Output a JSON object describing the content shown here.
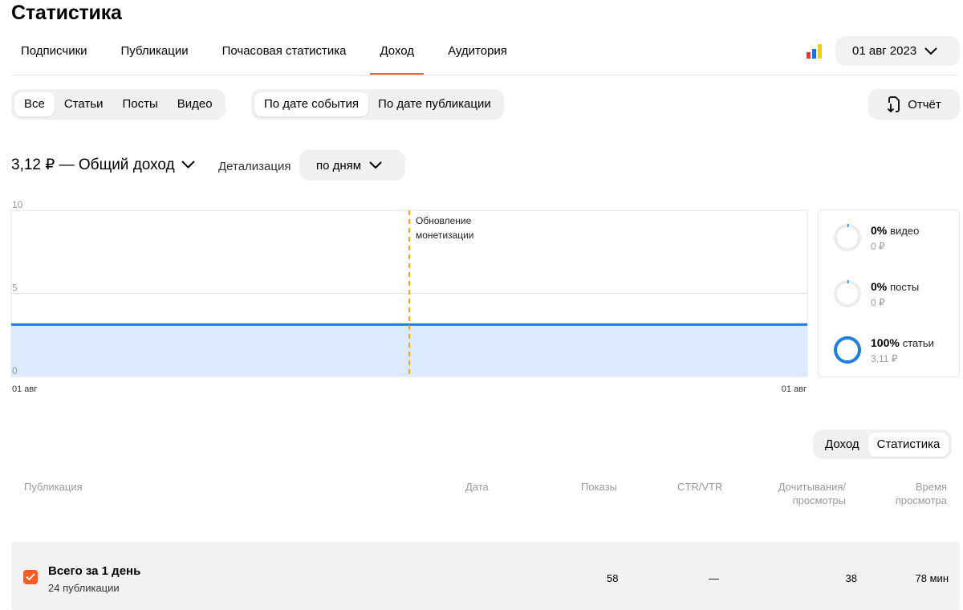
{
  "header": {
    "title": "Статистика"
  },
  "tabs": [
    {
      "label": "Подписчики"
    },
    {
      "label": "Публикации"
    },
    {
      "label": "Почасовая статистика"
    },
    {
      "label": "Доход",
      "active": true
    },
    {
      "label": "Аудитория"
    }
  ],
  "date_picker": {
    "value": "01 авг 2023",
    "icon": "chevron-down-icon"
  },
  "logo_colors": [
    "#ff3333",
    "#1b6fe6",
    "#ffcc00"
  ],
  "filters": {
    "type": [
      "Все",
      "Статьи",
      "Посты",
      "Видео"
    ],
    "type_active": "Все",
    "date_mode": [
      "По дате события",
      "По дате публикации"
    ],
    "date_mode_active": "По дате события"
  },
  "report_button": {
    "label": "Отчёт",
    "icon": "download-file-icon"
  },
  "income": {
    "label": "3,12 ₽ — Общий доход"
  },
  "detail": {
    "label": "Детализация",
    "value": "по дням"
  },
  "chart_data": {
    "type": "area",
    "x": [
      "01 авг",
      "01 авг"
    ],
    "yticks": [
      "10",
      "5",
      "0"
    ],
    "ylim": [
      0,
      10
    ],
    "series": [
      {
        "values": [
          3.12,
          3.12
        ],
        "color": "#1b7ee0",
        "fill": "#dbeafd"
      }
    ],
    "annotation": {
      "text_line1": "Обновление",
      "text_line2": "монетизации",
      "color": "#f5a623"
    },
    "grid": true
  },
  "breakdown": [
    {
      "pct": "0%",
      "label": "видео",
      "amount": "0 ₽",
      "fraction": 0
    },
    {
      "pct": "0%",
      "label": "посты",
      "amount": "0 ₽",
      "fraction": 0
    },
    {
      "pct": "100%",
      "label": "статьи",
      "amount": "3,11 ₽",
      "fraction": 1
    }
  ],
  "view_switch": {
    "options": [
      "Доход",
      "Статистика"
    ],
    "active": "Статистика"
  },
  "table": {
    "columns": {
      "publication": "Публикация",
      "date": "Дата",
      "views": "Показы",
      "ctr": "CTR/VTR",
      "read_l1": "Дочитывания/",
      "read_l2": "просмотры",
      "time_l1": "Время",
      "time_l2": "просмотра"
    },
    "total": {
      "title": "Всего за 1 день",
      "subtitle": "24 публикации",
      "views": "58",
      "ctr": "—",
      "reads": "38",
      "time": "78 мин"
    }
  },
  "accent_color": "#ff5a1f"
}
